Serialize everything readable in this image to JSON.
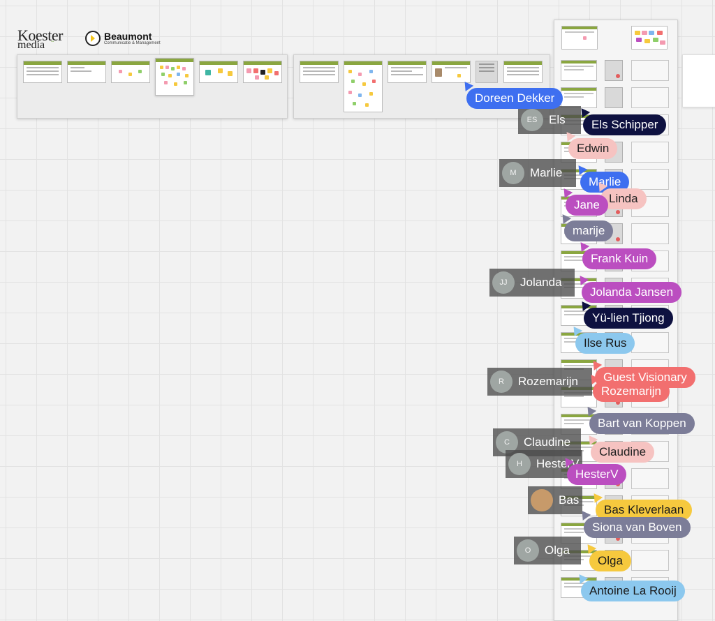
{
  "logos": {
    "koester": {
      "line1": "Koester",
      "line2": "media"
    },
    "beaumont": {
      "name": "Beaumont",
      "subtitle": "Communicatie & Management"
    }
  },
  "ghosts": [
    {
      "initials": "ES",
      "name": "Els"
    },
    {
      "initials": "M",
      "name": "Marlie"
    },
    {
      "initials": "JJ",
      "name": "Jolanda"
    },
    {
      "initials": "R",
      "name": "Rozemarijn"
    },
    {
      "initials": "C",
      "name": "Claudine"
    },
    {
      "initials": "H",
      "name": "HesterV"
    },
    {
      "initials": "",
      "name": "Bas"
    },
    {
      "initials": "O",
      "name": "Olga"
    }
  ],
  "cursors": [
    {
      "name": "Doreen Dekker",
      "color": "#3e6ff0",
      "text": "#ffffff"
    },
    {
      "name": "Els Schipper",
      "color": "#0e1140",
      "text": "#ffffff"
    },
    {
      "name": "Edwin",
      "color": "#f6c3c1",
      "text": "#222222"
    },
    {
      "name": "Marlie",
      "color": "#3e6ff0",
      "text": "#ffffff"
    },
    {
      "name": "Linda",
      "color": "#f6c3c1",
      "text": "#222222"
    },
    {
      "name": "Jane",
      "color": "#bb4ec0",
      "text": "#ffffff"
    },
    {
      "name": "marije",
      "color": "#7c7d98",
      "text": "#ffffff"
    },
    {
      "name": "Frank Kuin",
      "color": "#bb4ec0",
      "text": "#ffffff"
    },
    {
      "name": "Jolanda Jansen",
      "color": "#bb4ec0",
      "text": "#ffffff"
    },
    {
      "name": "Yü-lien Tjiong",
      "color": "#0e1140",
      "text": "#ffffff"
    },
    {
      "name": "Ilse Rus",
      "color": "#8cc8ee",
      "text": "#1a1a1a"
    },
    {
      "name": "Guest Visionary",
      "color": "#f26f6f",
      "text": "#ffffff"
    },
    {
      "name": "Rozemarijn",
      "color": "#f26f6f",
      "text": "#ffffff"
    },
    {
      "name": "Bart van Koppen",
      "color": "#7c7d98",
      "text": "#ffffff"
    },
    {
      "name": "Claudine",
      "color": "#f6c3c1",
      "text": "#222222"
    },
    {
      "name": "HesterV",
      "color": "#bb4ec0",
      "text": "#ffffff"
    },
    {
      "name": "Bas Kleverlaan",
      "color": "#f6c93e",
      "text": "#1a1a1a"
    },
    {
      "name": "Siona van Boven",
      "color": "#7c7d98",
      "text": "#ffffff"
    },
    {
      "name": "Olga",
      "color": "#f6c93e",
      "text": "#1a1a1a"
    },
    {
      "name": "Antoine La Rooij",
      "color": "#8cc8ee",
      "text": "#1a1a1a"
    }
  ],
  "colors": {
    "canvas": "#f2f2f2",
    "grid": "#e2e2e2",
    "template_header": "#8aa640"
  }
}
